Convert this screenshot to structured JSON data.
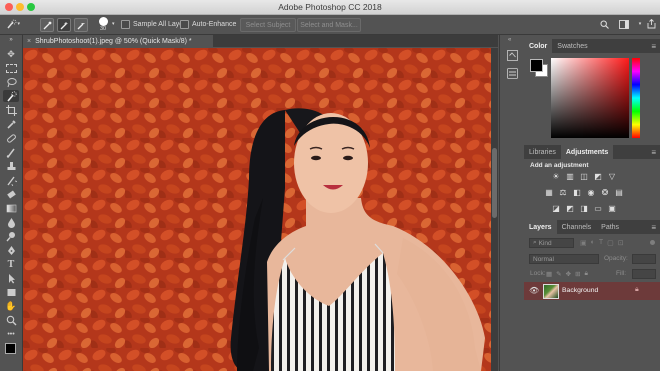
{
  "app_title": "Adobe Photoshop CC 2018",
  "options_bar": {
    "brush_size": "30",
    "sample_all_layers": "Sample All Layers",
    "auto_enhance": "Auto-Enhance",
    "select_subject": "Select Subject",
    "select_and_mask": "Select and Mask..."
  },
  "document": {
    "tab_title": "ShrubPhotoshoot(1).jpeg @ 50% (Quick Mask/8) *",
    "close_glyph": "×"
  },
  "color_panel": {
    "tabs": [
      "Color",
      "Swatches"
    ]
  },
  "adjust_panel": {
    "tabs": [
      "Libraries",
      "Adjustments"
    ],
    "heading": "Add an adjustment"
  },
  "layers_panel": {
    "tabs": [
      "Layers",
      "Channels",
      "Paths"
    ],
    "kind_placeholder": "Kind",
    "blend_mode": "Normal",
    "opacity_label": "Opacity:",
    "lock_label": "Lock:",
    "fill_label": "Fill:",
    "layer_name": "Background"
  },
  "colors": {
    "mask_overlay": "#d0401c",
    "foreground": "#000000",
    "background": "#ffffff",
    "selected_layer_bg": "#6d3a3a"
  }
}
